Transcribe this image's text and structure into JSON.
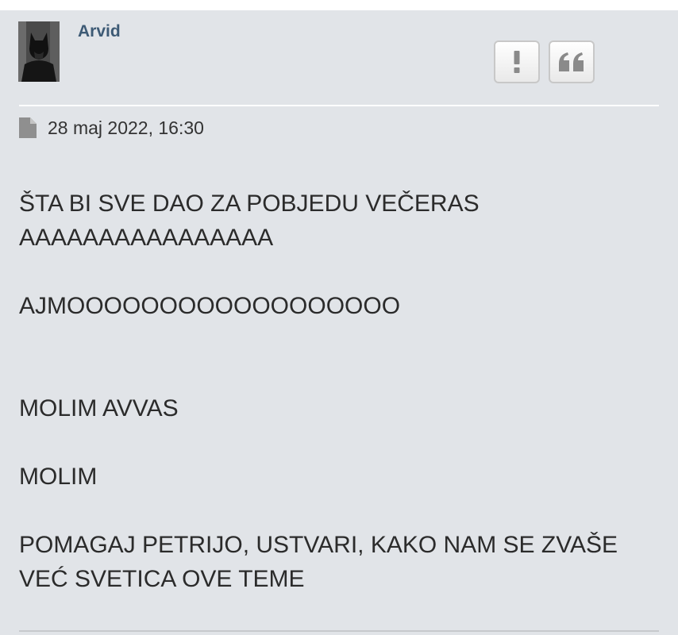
{
  "post": {
    "author": "Arvid",
    "timestamp": "28 maj 2022, 16:30",
    "lines": [
      "ŠTA BI SVE DAO ZA POBJEDU VEČERAS",
      "AAAAAAAAAAAAAAAA",
      "AJMOOOOOOOOOOOOOOOOOO",
      "MOLIM AVVAS",
      "MOLIM",
      "POMAGAJ PETRIJO, USTVARI, KAKO NAM SE ZVAŠE VEĆ SVETICA OVE TEME"
    ],
    "buttons": {
      "report_glyph": "!",
      "quote_glyph": "❝"
    },
    "icons": {
      "report": "exclamation-icon",
      "quote": "quote-icon",
      "timestamp": "file-icon"
    },
    "colors": {
      "background": "#e1e4e8",
      "username": "#3d5a75"
    }
  }
}
